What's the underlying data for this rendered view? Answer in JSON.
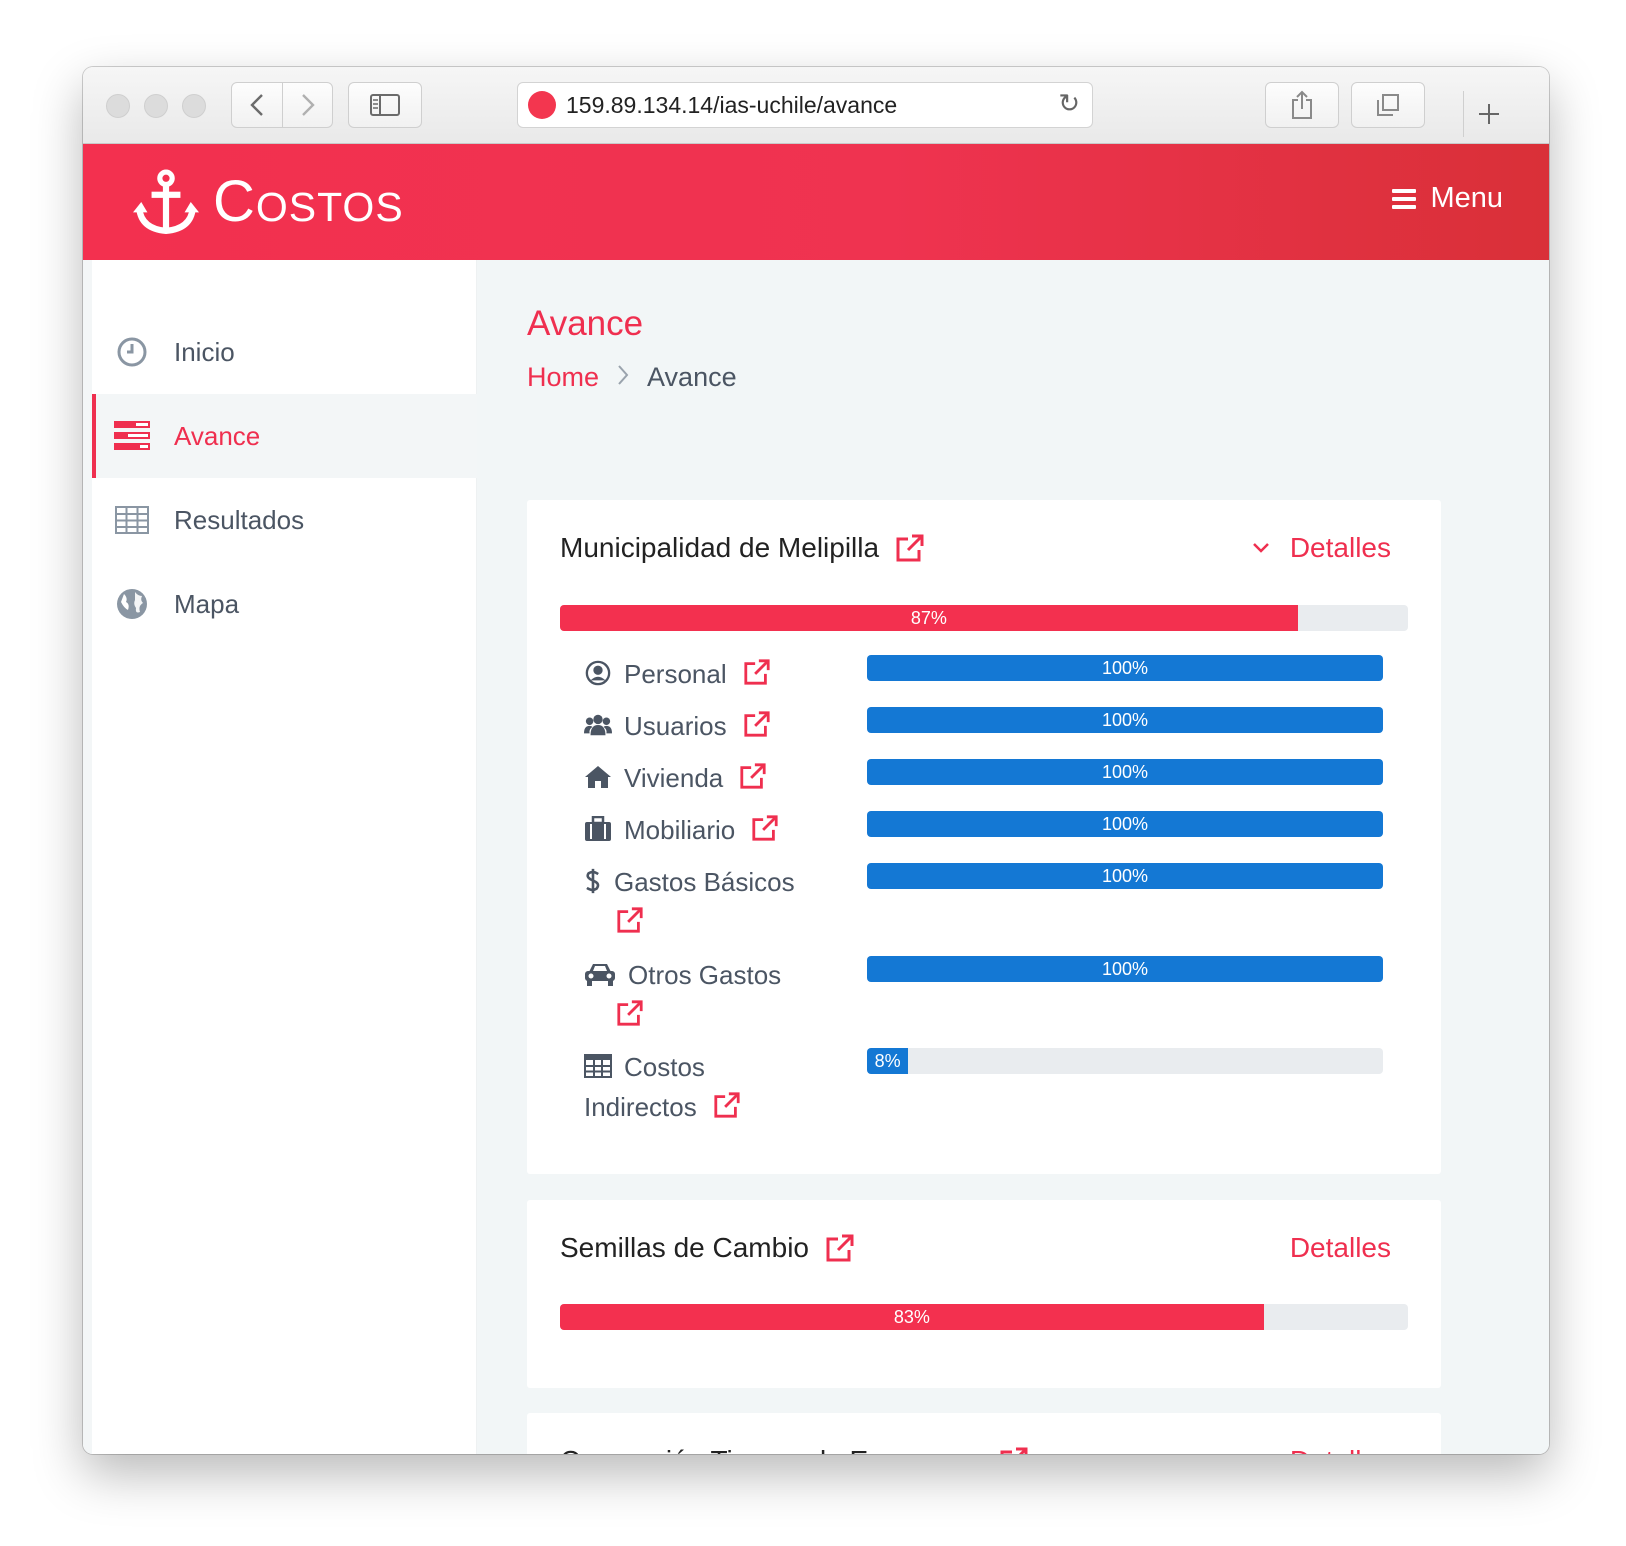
{
  "browser": {
    "url": "159.89.134.14/ias-uchile/avance"
  },
  "app": {
    "brand": "Costos",
    "menu_label": "Menu"
  },
  "sidebar": {
    "items": [
      {
        "label": "Inicio",
        "icon": "clock-icon",
        "active": false
      },
      {
        "label": "Avance",
        "icon": "tasks-icon",
        "active": true
      },
      {
        "label": "Resultados",
        "icon": "table-icon",
        "active": false
      },
      {
        "label": "Mapa",
        "icon": "globe-icon",
        "active": false
      }
    ]
  },
  "page": {
    "title": "Avance",
    "breadcrumb": {
      "home": "Home",
      "current": "Avance"
    }
  },
  "orgs": [
    {
      "name": "Municipalidad de Melipilla",
      "details_label": "Detalles",
      "progress": 87,
      "progress_label": "87%",
      "expanded": true,
      "categories": [
        {
          "label": "Personal",
          "icon": "user-circle-icon",
          "progress": 100,
          "progress_label": "100%"
        },
        {
          "label": "Usuarios",
          "icon": "users-icon",
          "progress": 100,
          "progress_label": "100%"
        },
        {
          "label": "Vivienda",
          "icon": "home-icon",
          "progress": 100,
          "progress_label": "100%"
        },
        {
          "label": "Mobiliario",
          "icon": "briefcase-icon",
          "progress": 100,
          "progress_label": "100%"
        },
        {
          "label": "Gastos Básicos",
          "icon": "dollar-icon",
          "progress": 100,
          "progress_label": "100%"
        },
        {
          "label": "Otros Gastos",
          "icon": "car-icon",
          "progress": 100,
          "progress_label": "100%"
        },
        {
          "label": "Costos Indirectos",
          "icon": "table-icon",
          "progress": 8,
          "progress_label": "8%"
        }
      ]
    },
    {
      "name": "Semillas de Cambio",
      "details_label": "Detalles",
      "progress": 83,
      "progress_label": "83%",
      "expanded": false
    },
    {
      "name": "Coperación Tiempo de Esperanza",
      "details_label": "Detalles"
    }
  ],
  "colors": {
    "accent": "#ef2f4f",
    "progress_blue": "#1478d4",
    "text_muted": "#4b5563",
    "main_bg": "#f2f6f7"
  }
}
